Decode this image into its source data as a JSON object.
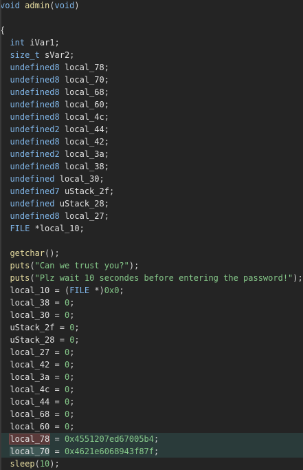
{
  "editor": {
    "lines": [
      {
        "t": "void admin(void)"
      },
      {
        "t": ""
      },
      {
        "t": "{"
      },
      {
        "t": "  int iVar1;"
      },
      {
        "t": "  size_t sVar2;"
      },
      {
        "t": "  undefined8 local_78;"
      },
      {
        "t": "  undefined8 local_70;"
      },
      {
        "t": "  undefined8 local_68;"
      },
      {
        "t": "  undefined8 local_60;"
      },
      {
        "t": "  undefined8 local_4c;"
      },
      {
        "t": "  undefined2 local_44;"
      },
      {
        "t": "  undefined8 local_42;"
      },
      {
        "t": "  undefined2 local_3a;"
      },
      {
        "t": "  undefined8 local_38;"
      },
      {
        "t": "  undefined local_30;"
      },
      {
        "t": "  undefined7 uStack_2f;"
      },
      {
        "t": "  undefined uStack_28;"
      },
      {
        "t": "  undefined8 local_27;"
      },
      {
        "t": "  FILE *local_10;"
      },
      {
        "t": ""
      },
      {
        "t": "  getchar();"
      },
      {
        "t": "  puts(\"Can we trust you?\");"
      },
      {
        "t": "  puts(\"Plz wait 10 secondes before entering the password!\");"
      },
      {
        "t": "  local_10 = (FILE *)0x0;"
      },
      {
        "t": "  local_38 = 0;"
      },
      {
        "t": "  local_30 = 0;"
      },
      {
        "t": "  uStack_2f = 0;"
      },
      {
        "t": "  uStack_28 = 0;"
      },
      {
        "t": "  local_27 = 0;"
      },
      {
        "t": "  local_42 = 0;"
      },
      {
        "t": "  local_3a = 0;"
      },
      {
        "t": "  local_4c = 0;"
      },
      {
        "t": "  local_44 = 0;"
      },
      {
        "t": "  local_68 = 0;"
      },
      {
        "t": "  local_60 = 0;"
      },
      {
        "t": "  local_78 = 0x4551207ed67005b4;",
        "hl": true
      },
      {
        "t": "  local_70 = 0x4621e6068943f87f;",
        "hl": true
      },
      {
        "t": "  sleep(10);"
      }
    ]
  },
  "colors": {
    "background": "#242424",
    "type": "#7fb4e6",
    "identifier": "#e0e0e0",
    "function": "#e6dca0",
    "string": "#86c98a",
    "number": "#86c98a",
    "highlight": "#2a3b3a"
  }
}
